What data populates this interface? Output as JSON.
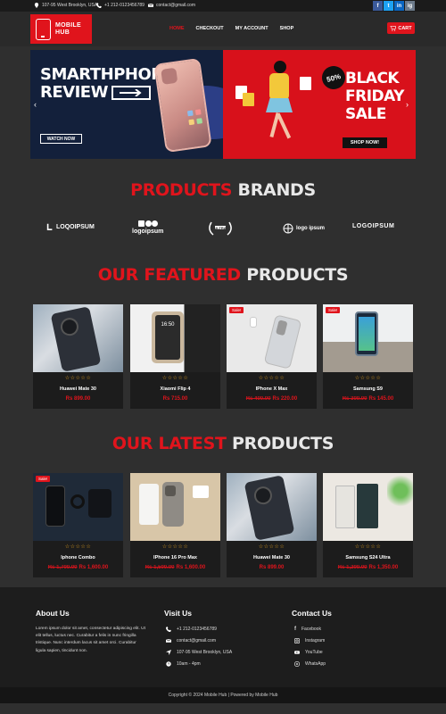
{
  "topbar": {
    "address": "107-95 West Brooklyn, USA",
    "phone": "+1 212-0123456789",
    "email": "contact@gmail.com",
    "socials": [
      "f",
      "t",
      "in",
      "ig"
    ]
  },
  "header": {
    "logo_line1": "MOBILE",
    "logo_line2": "HUB",
    "nav": [
      "HOME",
      "CHECKOUT",
      "MY ACCOUNT",
      "SHOP"
    ],
    "active_nav": "HOME",
    "cart_label": "CART"
  },
  "banner": {
    "left_title_1": "SMARTHPHONE",
    "left_title_2": "REVIEW",
    "left_button": "WATCH NOW",
    "right_badge": "50%",
    "right_title_1": "BLACK",
    "right_title_2": "FRIDAY",
    "right_title_3": "SALE",
    "right_button": "SHOP NOW!"
  },
  "brands_section": {
    "title_red": "PRODUCTS",
    "title_white": "BRANDS",
    "brands": [
      "LOQOIPSUM",
      "logoipsum",
      "ULTRA",
      "logo ipsum",
      "LOGOIPSUM"
    ]
  },
  "featured": {
    "title_red": "OUR FEATURED",
    "title_white": "PRODUCTS",
    "products": [
      {
        "name": "Huawei Mate 30",
        "price": "Rs 899.00",
        "old_price": "",
        "sale": false
      },
      {
        "name": "Xiaomi Flip 4",
        "price": "Rs 715.00",
        "old_price": "",
        "sale": false
      },
      {
        "name": "IPhone X Max",
        "price": "Rs 220.00",
        "old_price": "Rs 400.00",
        "sale": true
      },
      {
        "name": "Samsung S9",
        "price": "Rs 145.00",
        "old_price": "Rs 300.00",
        "sale": true
      }
    ]
  },
  "latest": {
    "title_red": "OUR LATEST",
    "title_white": "PRODUCTS",
    "products": [
      {
        "name": "Iphone Combo",
        "price": "Rs 1,600.00",
        "old_price": "Rs 1,700.00",
        "sale": true
      },
      {
        "name": "IPhone 16 Pro Max",
        "price": "Rs 1,600.00",
        "old_price": "Rs 1,500.00",
        "sale": false
      },
      {
        "name": "Huawei Mate 30",
        "price": "Rs 899.00",
        "old_price": "",
        "sale": false
      },
      {
        "name": "Samsung S24 Ultra",
        "price": "Rs 1,350.00",
        "old_price": "Rs 1,200.00",
        "sale": false
      }
    ]
  },
  "sale_label": "Sale!",
  "stars": "☆☆☆☆☆",
  "footer": {
    "about_title": "About Us",
    "about_text": "Lorem ipsum dolor sit amet, consectetur adipiscing elit. Ut elit tellus, luctus nec. Curabitur a felis in nunc fringilla tristique. Nunc interdum lacus sit amet orci. Curabitur ligula sapien, tincidunt non.",
    "visit_title": "Visit Us",
    "visit": [
      "+1 212-0123456789",
      "contact@gmail.com",
      "107-95 West Brooklyn, USA",
      "10am - 4pm"
    ],
    "contact_title": "Contact Us",
    "contact": [
      "Facebook",
      "Instagram",
      "YouTube",
      "WhatsApp"
    ],
    "copyright": "Copyright © 2024 Mobile Hub | Powered by Mobile Hub"
  },
  "colors": {
    "accent": "#e0141c",
    "background": "#2f2f2f",
    "card": "#1c1c1c",
    "footer": "#1d1d1d"
  }
}
